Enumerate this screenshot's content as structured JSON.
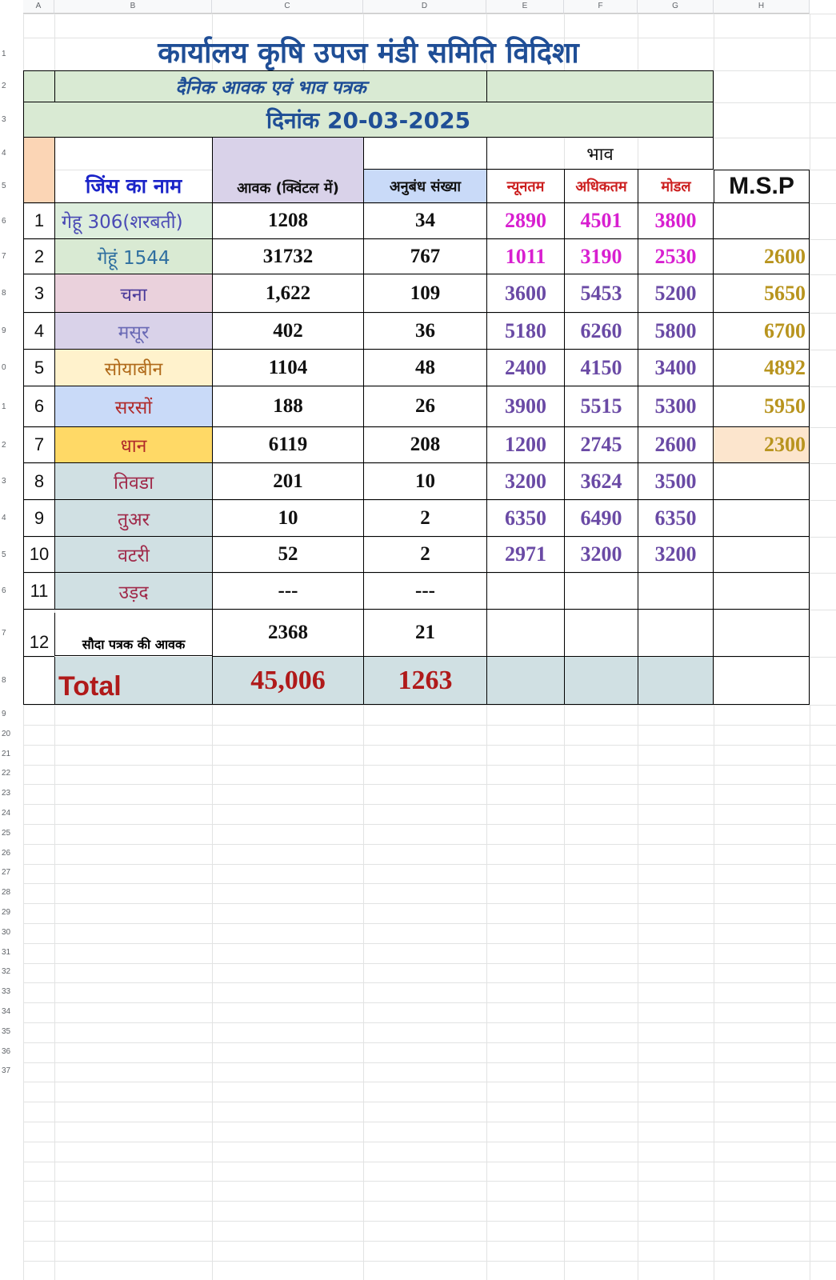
{
  "columns": [
    "A",
    "B",
    "C",
    "D",
    "E",
    "F",
    "G",
    "H"
  ],
  "row_numbers": [
    "1",
    "2",
    "3",
    "4",
    "5",
    "6",
    "7",
    "8",
    "9",
    "0",
    "1",
    "2",
    "3",
    "4",
    "5",
    "6",
    "7",
    "8",
    "9",
    "20",
    "21",
    "22",
    "23",
    "24",
    "25",
    "26",
    "27",
    "28",
    "29",
    "30",
    "31",
    "32",
    "33",
    "34",
    "35",
    "36",
    "37"
  ],
  "title": "कार्यालय कृषि उपज मंडी समिति विदिशा",
  "subtitle": "दैनिक आवक एवं भाव पत्रक",
  "date": "दिनांक 20-03-2025",
  "header": {
    "bhav": "भाव",
    "crop_name": "जिंस का नाम",
    "arrival": "आवक (क्विंटल में)",
    "contracts": "अनुबंध संख्या",
    "min": "न्यूनतम",
    "max": "अधिकतम",
    "modal": "मोडल",
    "msp": "M.S.P"
  },
  "colors": {
    "title": "#1f4e96",
    "min_price": "#d81fd0",
    "price": "#6a4aa5",
    "msp": "#b8941e",
    "total": "#b01a1a",
    "crop_header": "#1a23c8"
  },
  "rows": [
    {
      "sno": "1",
      "crop": "गेहू 306(शरबती)",
      "arrival": "1208",
      "contracts": "34",
      "min": "2890",
      "max": "4501",
      "modal": "3800",
      "msp": "",
      "bg": "#ddeedd",
      "fg": "#4a4ab5",
      "price_color": "#d81fd0"
    },
    {
      "sno": "2",
      "crop": "गेहूं 1544",
      "arrival": "31732",
      "contracts": "767",
      "min": "1011",
      "max": "3190",
      "modal": "2530",
      "msp": "2600",
      "bg": "#d9ead3",
      "fg": "#2f6fa0",
      "price_color": "#d81fd0"
    },
    {
      "sno": "3",
      "crop": "चना",
      "arrival": "1,622",
      "contracts": "109",
      "min": "3600",
      "max": "5453",
      "modal": "5200",
      "msp": "5650",
      "bg": "#ead1dc",
      "fg": "#4a3a9a",
      "price_color": "#6a4aa5"
    },
    {
      "sno": "4",
      "crop": "मसूर",
      "arrival": "402",
      "contracts": "36",
      "min": "5180",
      "max": "6260",
      "modal": "5800",
      "msp": "6700",
      "bg": "#d9d2e9",
      "fg": "#6a6ab5",
      "price_color": "#6a4aa5"
    },
    {
      "sno": "5",
      "crop": "सोयाबीन",
      "arrival": "1104",
      "contracts": "48",
      "min": "2400",
      "max": "4150",
      "modal": "3400",
      "msp": "4892",
      "bg": "#fff2cc",
      "fg": "#b06a1a",
      "price_color": "#6a4aa5"
    },
    {
      "sno": "6",
      "crop": "सरसों",
      "arrival": "188",
      "contracts": "26",
      "min": "3900",
      "max": "5515",
      "modal": "5300",
      "msp": "5950",
      "bg": "#c9daf8",
      "fg": "#b02a2a",
      "price_color": "#6a4aa5"
    },
    {
      "sno": "7",
      "crop": "धान",
      "arrival": "6119",
      "contracts": "208",
      "min": "1200",
      "max": "2745",
      "modal": "2600",
      "msp": "2300",
      "bg": "#ffd966",
      "fg": "#b02a2a",
      "price_color": "#6a4aa5"
    },
    {
      "sno": "8",
      "crop": "तिवडा",
      "arrival": "201",
      "contracts": "10",
      "min": "3200",
      "max": "3624",
      "modal": "3500",
      "msp": "",
      "bg": "#d0e0e3",
      "fg": "#a02a4a",
      "price_color": "#6a4aa5"
    },
    {
      "sno": "9",
      "crop": "तुअर",
      "arrival": "10",
      "contracts": "2",
      "min": "6350",
      "max": "6490",
      "modal": "6350",
      "msp": "",
      "bg": "#d0e0e3",
      "fg": "#a02a4a",
      "price_color": "#6a4aa5"
    },
    {
      "sno": "10",
      "crop": "वटरी",
      "arrival": "52",
      "contracts": "2",
      "min": "2971",
      "max": "3200",
      "modal": "3200",
      "msp": "",
      "bg": "#d0e0e3",
      "fg": "#a02a4a",
      "price_color": "#6a4aa5"
    },
    {
      "sno": "11",
      "crop": "उड़द",
      "arrival": "---",
      "contracts": "---",
      "min": "",
      "max": "",
      "modal": "",
      "msp": "",
      "bg": "#d0e0e3",
      "fg": "#a02a4a",
      "price_color": "#6a4aa5"
    },
    {
      "sno": "12",
      "crop": "सौदा पत्रक की आवक",
      "arrival": "2368",
      "contracts": "21",
      "min": "",
      "max": "",
      "modal": "",
      "msp": "",
      "bg": "#ffff00",
      "fg": "#000000",
      "price_color": "#6a4aa5"
    }
  ],
  "total": {
    "label": "Total",
    "arrival": "45,006",
    "contracts": "1263"
  }
}
